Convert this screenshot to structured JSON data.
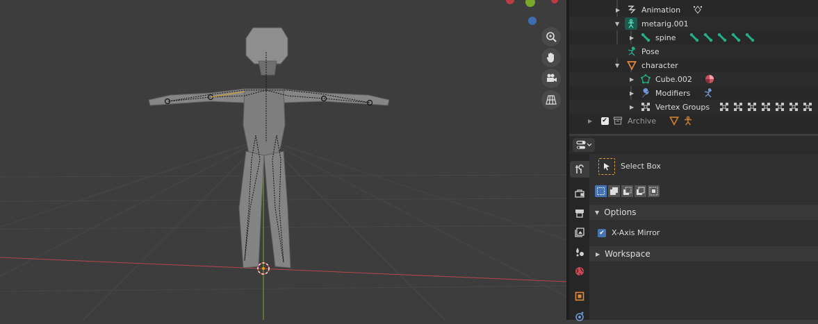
{
  "outliner": {
    "rows": [
      {
        "label": "Animation",
        "icon": "animation-icon",
        "extra_icon": "keyframe-icon"
      },
      {
        "label": "metarig.001",
        "icon": "armature-data-icon"
      },
      {
        "label": "spine",
        "icon": "bone-icon",
        "extra_icons": [
          "bone-icon",
          "bone-icon",
          "bone-icon",
          "bone-icon",
          "bone-icon"
        ]
      },
      {
        "label": "Pose",
        "icon": "pose-icon"
      },
      {
        "label": "character",
        "icon": "mesh-object-icon"
      },
      {
        "label": "Cube.002",
        "icon": "mesh-data-icon",
        "extra_icon": "material-icon"
      },
      {
        "label": "Modifiers",
        "icon": "wrench-icon",
        "extra_icon": "armature-modifier-icon"
      },
      {
        "label": "Vertex Groups",
        "icon": "vertex-groups-icon",
        "extra_icons": [
          "vertex-group-icon",
          "vertex-group-icon",
          "vertex-group-icon",
          "vertex-group-icon",
          "vertex-group-icon",
          "vertex-group-icon",
          "vertex-group-icon"
        ]
      },
      {
        "label": "Archive",
        "icon": "collection-icon",
        "checked": true
      }
    ]
  },
  "properties": {
    "tool_name": "Select Box",
    "options_header": "Options",
    "xmirror_label": "X-Axis Mirror",
    "xmirror_checked": true,
    "workspace_header": "Workspace"
  },
  "colors": {
    "viewport_bg": "#3d3d3d",
    "x_axis": "#c04848",
    "y_axis": "#6e9a34",
    "accent": "#4772b3",
    "bone_teal": "#23b08a",
    "object_orange": "#e0893a"
  }
}
